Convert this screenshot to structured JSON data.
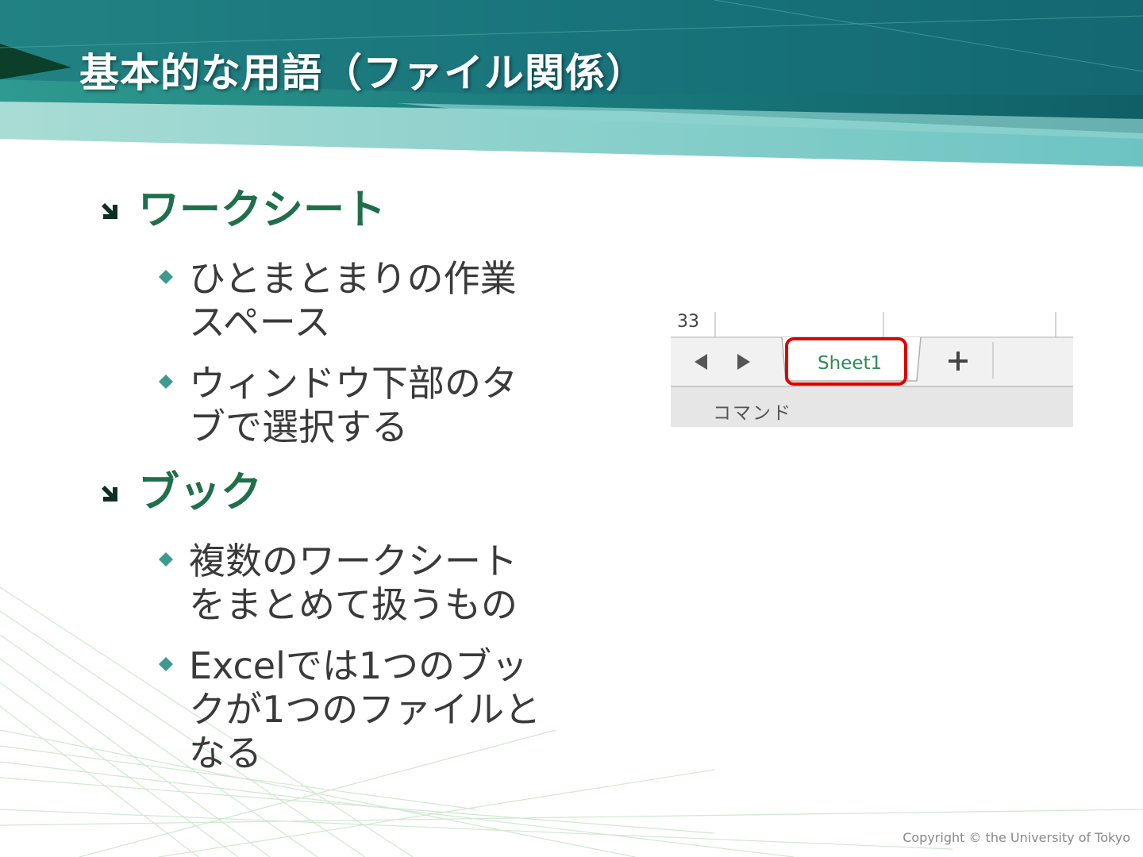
{
  "slide": {
    "title": "基本的な用語（ファイル関係）"
  },
  "bullets": [
    {
      "heading": "ワークシート",
      "items": [
        "ひとまとまりの作業スペース",
        "ウィンドウ下部のタブで選択する"
      ]
    },
    {
      "heading": "ブック",
      "items": [
        "複数のワークシートをまとめて扱うもの",
        "Excelでは1つのブックが1つのファイルとなる"
      ]
    }
  ],
  "excel_snippet": {
    "row_number": "33",
    "sheet_tab": "Sheet1",
    "add_sheet_icon": "plus-icon",
    "prev_icon": "triangle-left-icon",
    "next_icon": "triangle-right-icon",
    "status_text": "コマンド",
    "highlight_color": "#e00000"
  },
  "footer": {
    "copyright": "Copyright © the University of Tokyo"
  },
  "colors": {
    "banner_dark": "#0f5f66",
    "banner_light": "#8fd3cf",
    "heading_green": "#1f6f4a",
    "bullet_teal": "#3e9a8e"
  }
}
